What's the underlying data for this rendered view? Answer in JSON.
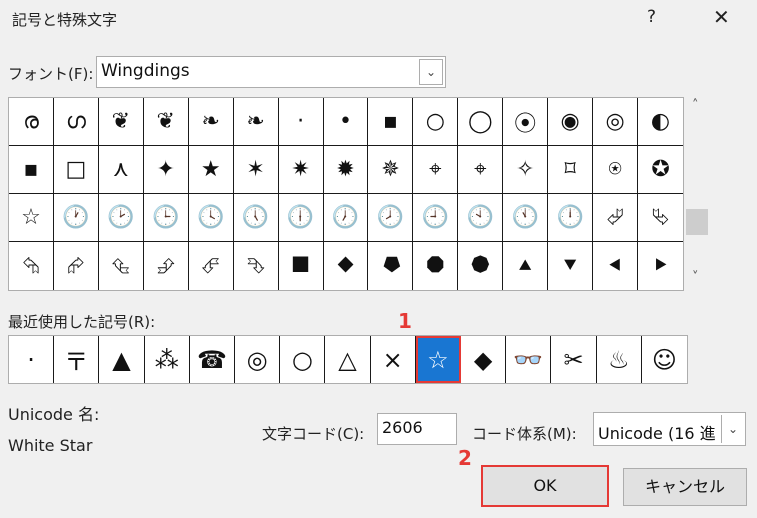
{
  "window": {
    "title": "記号と特殊文字",
    "help_glyph": "?",
    "close_glyph": "✕"
  },
  "font": {
    "label": "フォント(F):",
    "value": "Wingdings",
    "dropdown_glyph": "⌄"
  },
  "grid": {
    "cells": [
      "ര",
      "ഗ",
      "❦",
      "❦",
      "❧",
      "❧",
      "·",
      "•",
      "▪",
      "○",
      "◯",
      "⦿",
      "◉",
      "◎",
      "◐",
      "▪",
      "□",
      "⋏",
      "✦",
      "★",
      "✶",
      "✷",
      "✹",
      "✵",
      "⌖",
      "⌖",
      "✧",
      "⌑",
      "⍟",
      "✪",
      "☆",
      "🕐",
      "🕑",
      "🕒",
      "🕓",
      "🕔",
      "🕕",
      "🕖",
      "🕗",
      "🕘",
      "🕙",
      "🕚",
      "🕛",
      "⮰",
      "⮱",
      "⮲",
      "⮳",
      "⮴",
      "⮵",
      "⮶",
      "⮷",
      "⯀",
      "⯁",
      "⯂",
      "⯃",
      "⯄",
      "⯅",
      "⯆",
      "⯇",
      "⯈"
    ],
    "scroll_up_glyph": "˄",
    "scroll_down_glyph": "˅"
  },
  "recent": {
    "label": "最近使用した記号(R):",
    "cells": [
      "·",
      "〒",
      "▲",
      "⁂",
      "☎",
      "◎",
      "○",
      "△",
      "×",
      "☆",
      "◆",
      "👓",
      "✂",
      "♨",
      "☺"
    ],
    "selected_index": 9
  },
  "annotations": {
    "one": "1",
    "two": "2"
  },
  "unicode_name": {
    "label": "Unicode 名:",
    "value": "White Star"
  },
  "char_code": {
    "label": "文字コード(C):",
    "value": "2606"
  },
  "code_system": {
    "label": "コード体系(M):",
    "value": "Unicode (16 進",
    "dropdown_glyph": "⌄"
  },
  "buttons": {
    "ok": "OK",
    "cancel": "キャンセル"
  },
  "colors": {
    "selected_bg": "#1976d2",
    "highlight_red": "#e53935",
    "ok_border": "#0078d7"
  }
}
